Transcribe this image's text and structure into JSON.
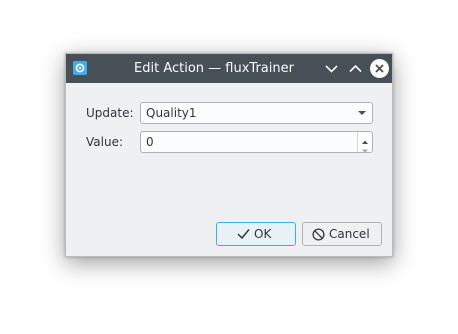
{
  "window": {
    "title": "Edit Action — fluxTrainer",
    "icon": "app-settings-icon",
    "controls": [
      "minimize-chevron-down-icon",
      "maximize-chevron-up-icon",
      "close-icon"
    ]
  },
  "form": {
    "update_label": "Update:",
    "update_value": "Quality1",
    "value_label": "Value:",
    "value_value": "0"
  },
  "buttons": {
    "ok_label": "OK",
    "ok_icon": "checkmark-icon",
    "cancel_label": "Cancel",
    "cancel_icon": "cancel-circle-icon"
  },
  "colors": {
    "titlebar": "#475057",
    "dialog_bg": "#eff0f1",
    "accent": "#3daee9",
    "text": "#31363b"
  }
}
